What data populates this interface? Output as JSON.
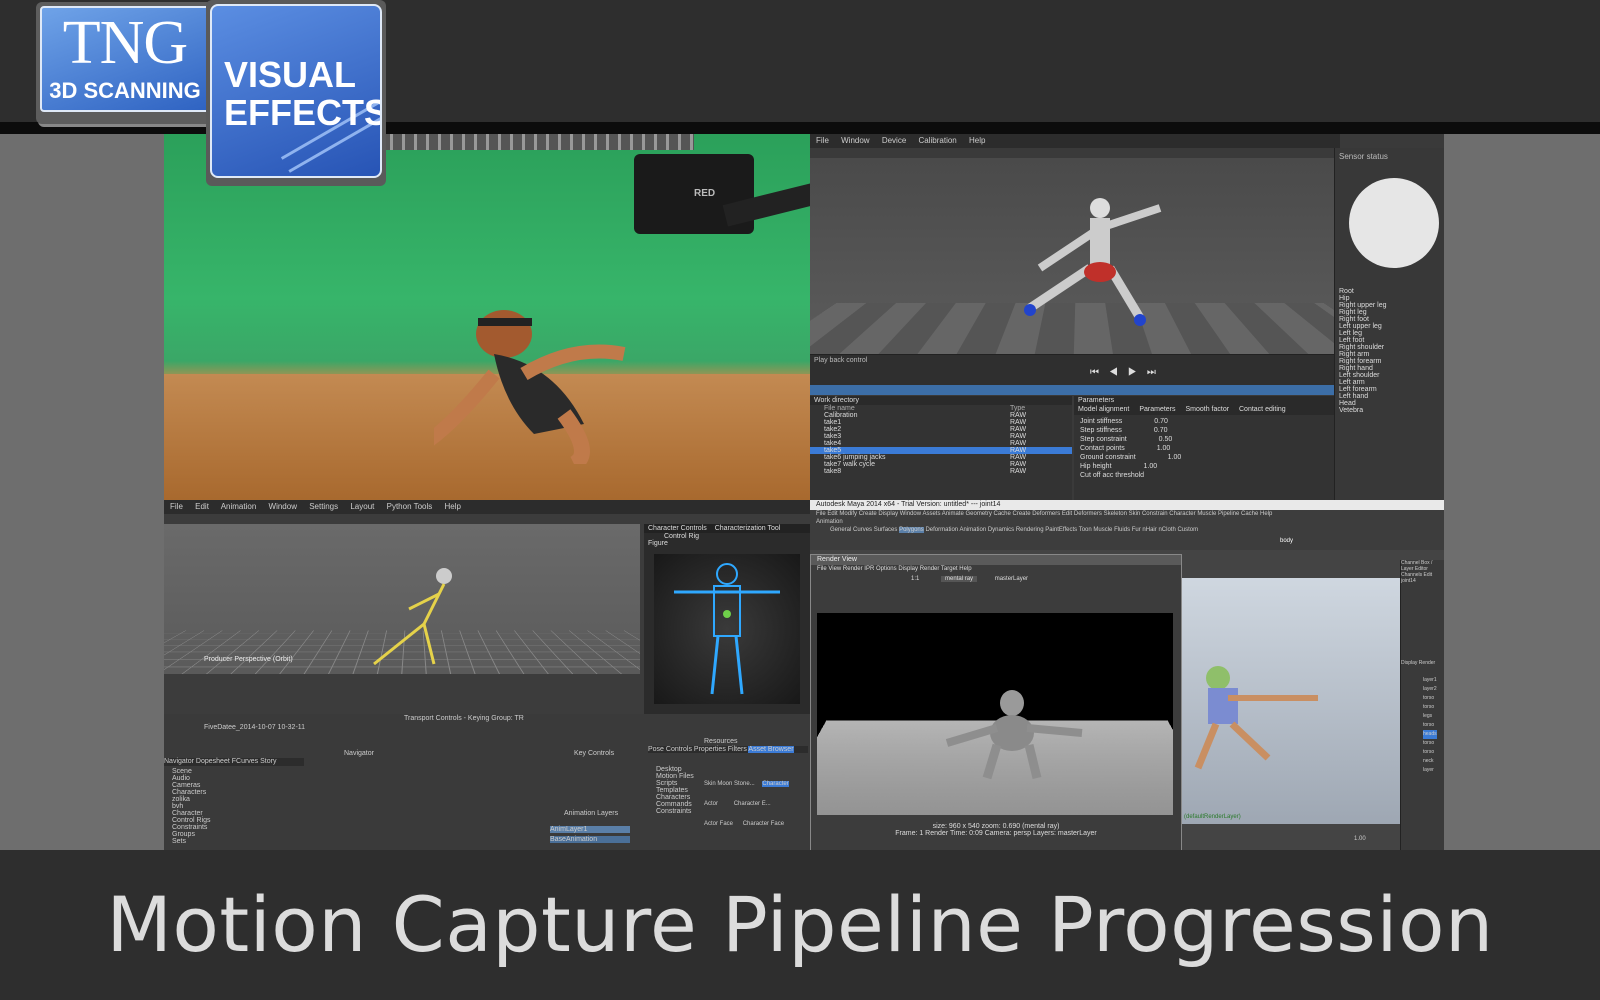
{
  "caption": "Motion Capture Pipeline Progression",
  "logo": {
    "tng": "TNG",
    "scanning": "3D SCANNING",
    "visual": "VISUAL",
    "effects": "EFFECTS"
  },
  "greenscreen": {
    "camera_label": "RED"
  },
  "motion_capture_app": {
    "menu": [
      "File",
      "Window",
      "Device",
      "Calibration",
      "Help"
    ],
    "sensor_panel_title": "Sensor status",
    "tree_items": [
      "Root",
      "Hip",
      "Right upper leg",
      "Right leg",
      "Right foot",
      "Left upper leg",
      "Left leg",
      "Left foot",
      "Right shoulder",
      "Right arm",
      "Right forearm",
      "Right hand",
      "Left shoulder",
      "Left arm",
      "Left forearm",
      "Left hand",
      "Head",
      "Vetebra"
    ],
    "playback_label": "Play back control",
    "file_panel_title": "Work directory",
    "file_header": [
      "File name",
      "Type"
    ],
    "files": [
      {
        "name": "Calibration",
        "type": "RAW"
      },
      {
        "name": "take1",
        "type": "RAW"
      },
      {
        "name": "take2",
        "type": "RAW"
      },
      {
        "name": "take3",
        "type": "RAW"
      },
      {
        "name": "take4",
        "type": "RAW"
      },
      {
        "name": "take5",
        "type": "RAW"
      },
      {
        "name": "take6 jumping jacks",
        "type": "RAW"
      },
      {
        "name": "take7 walk cycle",
        "type": "RAW"
      },
      {
        "name": "take8",
        "type": "RAW"
      }
    ],
    "params_title": "Parameters",
    "params_tabs": [
      "Model alignment",
      "Parameters",
      "Smooth factor",
      "Contact editing"
    ],
    "params_labels": [
      "Joint stiffness",
      "Step stiffness",
      "Step constraint",
      "Contact points",
      "Ground constraint",
      "Hip height",
      "Cut off acc threshold"
    ],
    "param_values": [
      "0.70",
      "0.70",
      "0.50",
      "1.00",
      "1.00",
      "1.00"
    ]
  },
  "motionbuilder": {
    "menu": [
      "File",
      "Edit",
      "Animation",
      "Window",
      "Settings",
      "Layout",
      "Python Tools",
      "Help"
    ],
    "viewer_label": "Producer Perspective (Orbit)",
    "char_tabs": [
      "Character Controls",
      "Characterization Tool"
    ],
    "char_control": "Control Rig",
    "figure_tab": "Figure",
    "transport": "Transport Controls - Keying Group: TR",
    "take": "FiveDatee_2014-10-07 10-32-11",
    "navigator": "Navigator",
    "nav_tabs": [
      "Navigator",
      "Dopesheet",
      "FCurves",
      "Story",
      "Animation Trigger"
    ],
    "nav_tree": [
      "Scene",
      "Audio",
      "Cameras",
      "Characters",
      "zolika",
      "bvh",
      "Character",
      "Control Rigs",
      "Constraints",
      "Groups",
      "Sets",
      "Lights",
      "Materials",
      "Poses",
      "Shaders",
      "Takes"
    ],
    "key_controls": "Key Controls",
    "anim_layers": "Animation Layers",
    "layers": [
      "AnimLayer1",
      "BaseAnimation"
    ],
    "resources": "Resources",
    "resource_tabs": [
      "Pose Controls",
      "Properties",
      "Filters",
      "Asset Browser",
      "Groups",
      "Sets"
    ],
    "assets": [
      "Desktop",
      "Desktop",
      "Desktop",
      "Motion Files",
      "Motion Files",
      "Scripts",
      "Templates",
      "Characters",
      "Commands",
      "Constraints",
      "Devices"
    ],
    "asset_icons": [
      "Skin Moon Stone...",
      "Character",
      "Actor",
      "Character E...",
      "Actor Face",
      "Character Face"
    ]
  },
  "maya": {
    "title": "Autodesk Maya 2014 x64 - Trial Version: untitled* --- joint14",
    "menu": [
      "File",
      "Edit",
      "Modify",
      "Create",
      "Display",
      "Window",
      "Assets",
      "Animate",
      "Geometry Cache",
      "Create Deformers",
      "Edit Deformers",
      "Skeleton",
      "Skin",
      "Constrain",
      "Character",
      "Muscle",
      "Pipeline Cache",
      "Help"
    ],
    "mode": "Animation",
    "shelf_tabs": [
      "General",
      "Curves",
      "Surfaces",
      "Polygons",
      "Deformation",
      "Animation",
      "Dynamics",
      "Rendering",
      "PaintEffects",
      "Toon",
      "Muscle",
      "Fluids",
      "Fur",
      "nHair",
      "nCloth",
      "Custom"
    ],
    "shelf_body": "body",
    "render_view_title": "Render View",
    "render_menu": [
      "File",
      "View",
      "Render",
      "IPR",
      "Options",
      "Display",
      "Render Target",
      "Help"
    ],
    "render_ratio": "1:1",
    "render_layer": "masterLayer",
    "render_mode": "mental ray",
    "render_info": "size: 960 x 540  zoom: 0.690     (mental ray)",
    "render_info2": "Frame: 1     Render Time: 0:09     Camera: persp     Layers: masterLayer",
    "channel_box": "Channel Box / Layer Editor",
    "channels": [
      "Channels",
      "Edit",
      "Object",
      "Show"
    ],
    "joint": "joint14",
    "display_tabs": [
      "Display",
      "Render",
      "Anim"
    ],
    "layer_list": [
      "layer1",
      "layer2",
      "torso",
      "torso",
      "legs",
      "torso",
      "heads",
      "torso",
      "torso",
      "neck",
      "layer"
    ],
    "layer_bottom": "(defaultRenderLayer)",
    "frame_end": "1.00"
  }
}
